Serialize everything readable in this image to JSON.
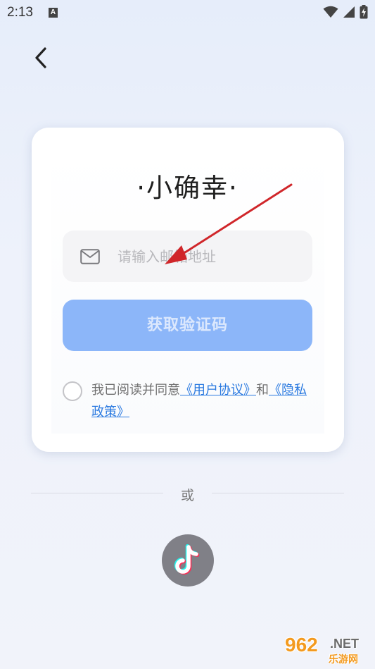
{
  "status_bar": {
    "time": "2:13",
    "notification_icon": "a-icon",
    "icons": [
      "wifi-icon",
      "signal-icon",
      "battery-icon"
    ]
  },
  "header": {
    "back_icon": "chevron-left-icon"
  },
  "card": {
    "title": "·小确幸·",
    "email": {
      "icon": "mail-icon",
      "placeholder": "请输入邮箱地址",
      "value": ""
    },
    "get_code_label": "获取验证码",
    "agreement": {
      "checked": false,
      "prefix": "我已阅读并同意",
      "user_agreement": "《用户协议》",
      "and": "和",
      "privacy_policy": "《隐私政策》"
    }
  },
  "divider": {
    "label": "或"
  },
  "third_party": {
    "tiktok_icon": "tiktok-icon"
  },
  "watermark": {
    "number": "962",
    "domain": ".NET",
    "site": "乐游网"
  },
  "colors": {
    "background": "#e6edfa",
    "button": "#8cb6f9",
    "link": "#2b7ae0",
    "annotation_arrow": "#d0262a"
  }
}
